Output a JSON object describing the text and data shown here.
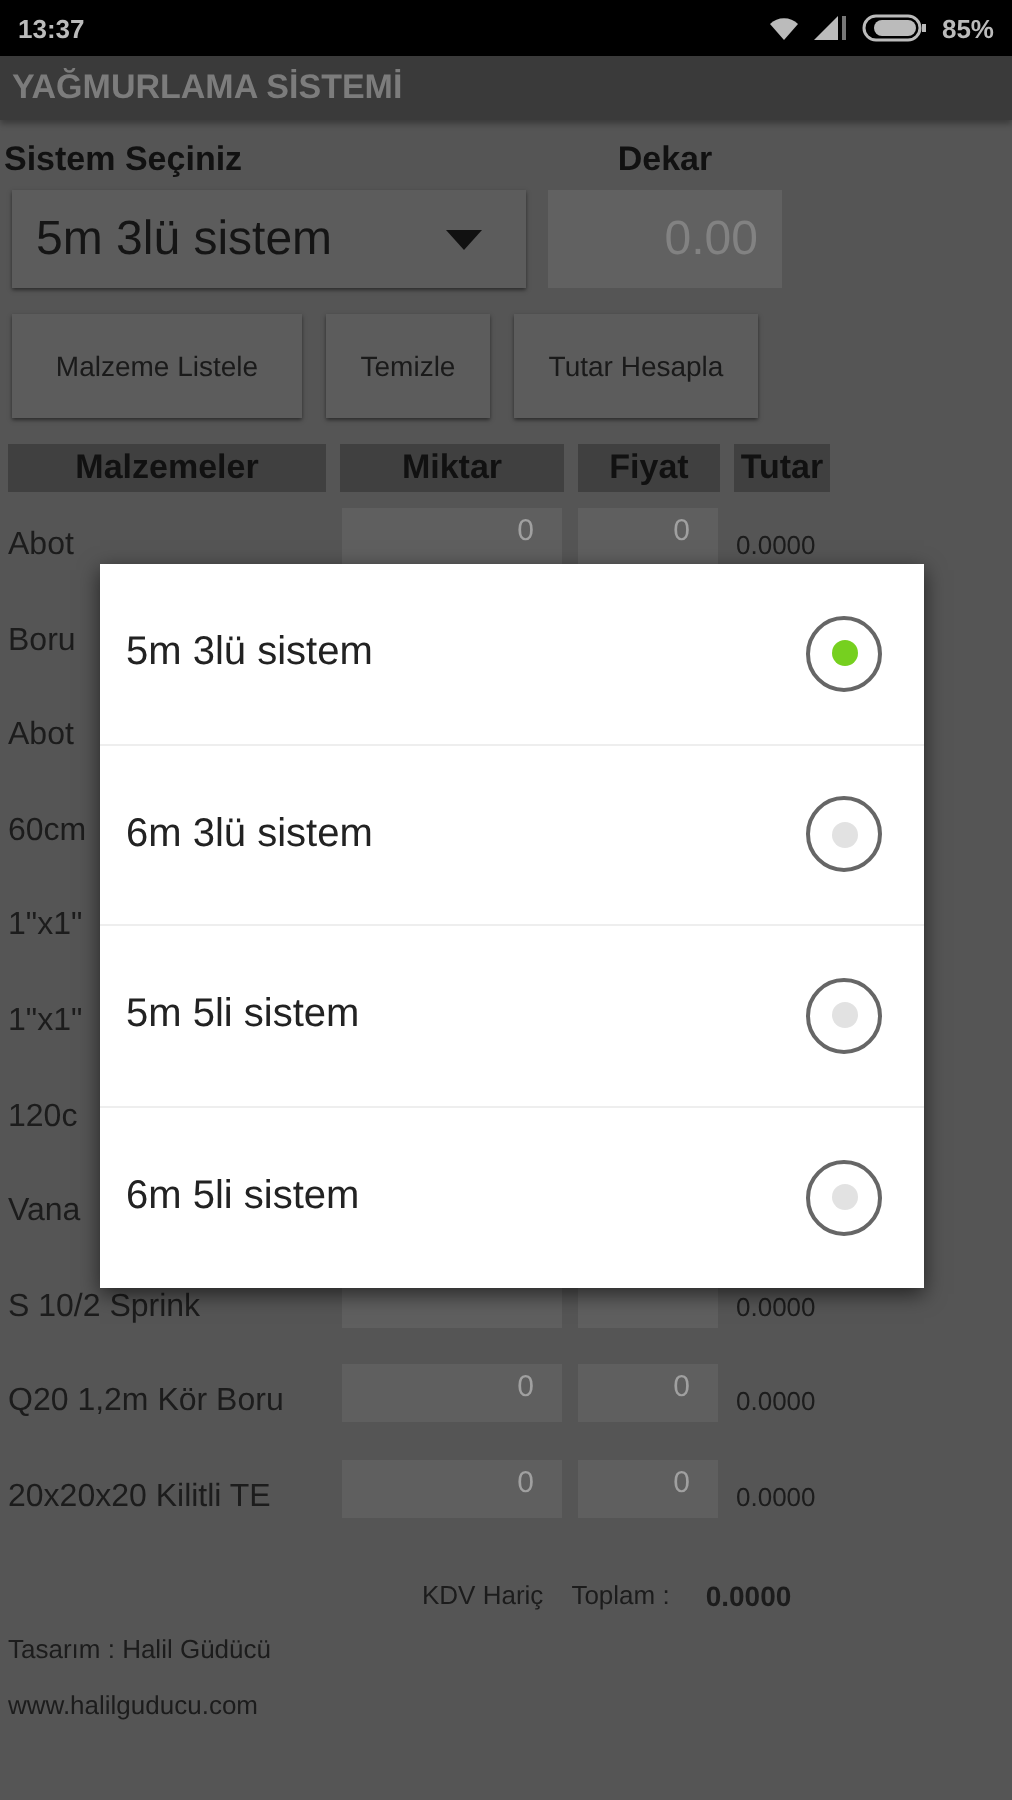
{
  "status_bar": {
    "time": "13:37",
    "battery": "85%"
  },
  "app_bar": {
    "title": "YAĞMURLAMA SİSTEMİ"
  },
  "form": {
    "system_label": "Sistem Seçiniz",
    "system_value": "5m 3lü sistem",
    "dekar_label": "Dekar",
    "dekar_value": "0.00"
  },
  "buttons": [
    "Malzeme Listele",
    "Temizle",
    "Tutar Hesapla"
  ],
  "table": {
    "columns": [
      "Malzemeler",
      "Miktar",
      "Fiyat",
      "Tutar"
    ],
    "rows": [
      {
        "kind": "full",
        "name": "Abot",
        "quantity": "0",
        "price": "0",
        "total": "0.0000"
      },
      {
        "kind": "name_only",
        "name": "Boru"
      },
      {
        "kind": "name_only",
        "name": "Abot"
      },
      {
        "kind": "name_only",
        "name": "60cm"
      },
      {
        "kind": "name_only",
        "name": "1\"x1\""
      },
      {
        "kind": "name_only",
        "name": "1\"x1\""
      },
      {
        "kind": "name_only",
        "name": "120c"
      },
      {
        "kind": "name_only",
        "name": "Vana"
      },
      {
        "kind": "partial",
        "name": "S 10/2 Sprink",
        "total": "0.0000"
      },
      {
        "kind": "full",
        "name": "Q20 1,2m Kör Boru",
        "quantity": "0",
        "price": "0",
        "total": "0.0000"
      },
      {
        "kind": "full",
        "name": "20x20x20 Kilitli TE",
        "quantity": "0",
        "price": "0",
        "total": "0.0000"
      }
    ]
  },
  "totals": {
    "vat_note": "KDV Hariç",
    "label": "Toplam :",
    "value": "0.0000"
  },
  "footer": {
    "credit": "Tasarım : Halil Güdücü",
    "website": "www.halilguducu.com"
  },
  "dialog": {
    "options": [
      {
        "label": "5m 3lü sistem",
        "selected": true
      },
      {
        "label": "6m 3lü sistem",
        "selected": false
      },
      {
        "label": "5m 5li sistem",
        "selected": false
      },
      {
        "label": "6m 5li sistem",
        "selected": false
      }
    ]
  }
}
